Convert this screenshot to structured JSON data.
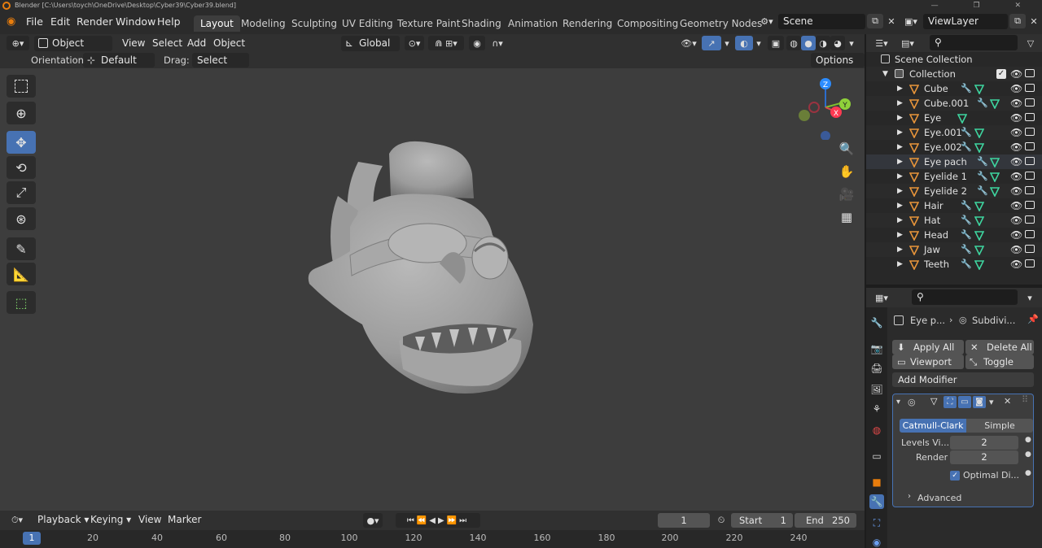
{
  "window": {
    "title": "Blender [C:\\Users\\toych\\OneDrive\\Desktop\\Cyber39\\Cyber39.blend]"
  },
  "menu": [
    "File",
    "Edit",
    "Render",
    "Window",
    "Help"
  ],
  "workspaces": [
    "Layout",
    "Modeling",
    "Sculpting",
    "UV Editing",
    "Texture Paint",
    "Shading",
    "Animation",
    "Rendering",
    "Compositing",
    "Geometry Nodes"
  ],
  "scene": {
    "name": "Scene"
  },
  "view_layer": {
    "name": "ViewLayer"
  },
  "viewport_header": {
    "mode": "Object Mode",
    "menus": [
      "View",
      "Select",
      "Add",
      "Object"
    ],
    "transform_orientation": "Global",
    "options": "Options"
  },
  "tool_settings": {
    "orientation_label": "Orientation:",
    "orientation_value": "Default",
    "drag_label": "Drag:",
    "drag_value": "Select Box"
  },
  "gizmo": {
    "x": "X",
    "y": "Y",
    "z": "Z"
  },
  "outliner": {
    "root": "Scene Collection",
    "collection": "Collection",
    "items": [
      "Cube",
      "Cube.001",
      "Eye",
      "Eye.001",
      "Eye.002",
      "Eye pach",
      "Eyelide 1",
      "Eyelide 2",
      "Hair",
      "Hat",
      "Head",
      "Jaw",
      "Teeth"
    ]
  },
  "properties": {
    "breadcrumb_object": "Eye p...",
    "breadcrumb_modifier": "Subdivi...",
    "apply_all": "Apply All",
    "delete_all": "Delete All",
    "viewport_vis": "Viewport Vis",
    "toggle_stack": "Toggle Stack",
    "add_modifier": "Add Modifier",
    "catmull_clark": "Catmull-Clark",
    "simple": "Simple",
    "levels_viewport_label": "Levels Vi...",
    "levels_viewport_value": "2",
    "render_label": "Render",
    "render_value": "2",
    "optimal_display": "Optimal Di...",
    "advanced": "Advanced"
  },
  "timeline": {
    "menus": [
      "Playback",
      "Keying",
      "View",
      "Marker"
    ],
    "current_frame": "1",
    "start_label": "Start",
    "start_value": "1",
    "end_label": "End",
    "end_value": "250",
    "ruler_current": "1",
    "ticks": [
      "20",
      "40",
      "60",
      "80",
      "100",
      "120",
      "140",
      "160",
      "180",
      "200",
      "220",
      "240"
    ]
  },
  "colors": {
    "accent": "#4772b3",
    "mesh_icon": "#e8953a",
    "modifier_icon": "#6a9ef0",
    "data_icon": "#3ed6a0"
  }
}
